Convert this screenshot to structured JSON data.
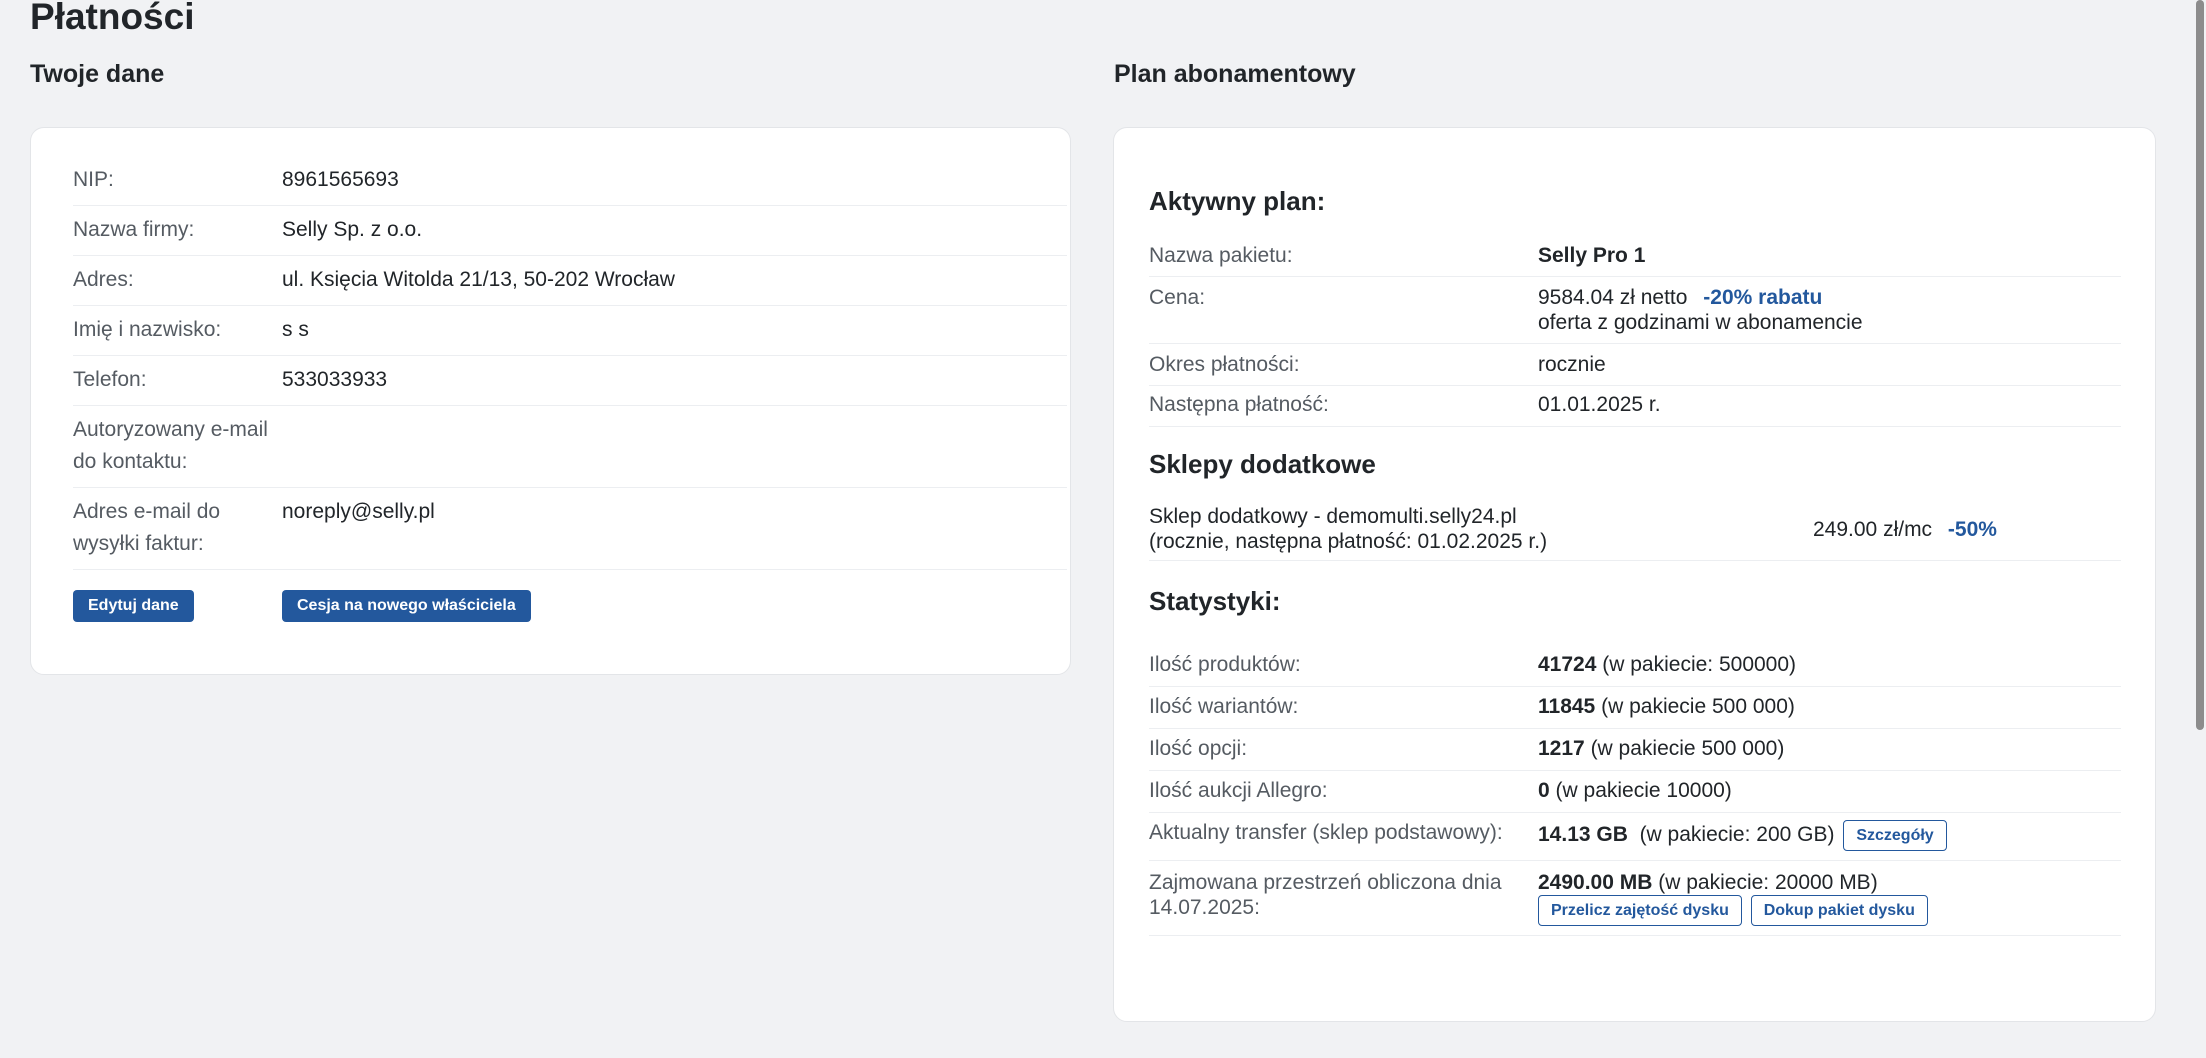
{
  "page": {
    "title": "Płatności"
  },
  "left": {
    "heading": "Twoje dane",
    "rows": [
      {
        "label": "NIP:",
        "value": "8961565693"
      },
      {
        "label": "Nazwa firmy:",
        "value": "Selly Sp. z o.o."
      },
      {
        "label": "Adres:",
        "value": "ul. Księcia Witolda 21/13, 50-202 Wrocław"
      },
      {
        "label": "Imię i nazwisko:",
        "value": "s s"
      },
      {
        "label": "Telefon:",
        "value": "533033933"
      },
      {
        "label": "Autoryzowany e-mail do kontaktu:",
        "value": ""
      },
      {
        "label": "Adres e-mail do wysyłki faktur:",
        "value": "noreply@selly.pl"
      }
    ],
    "edit_button": "Edytuj dane",
    "transfer_button": "Cesja na nowego właściciela"
  },
  "right": {
    "heading": "Plan abonamentowy",
    "active": {
      "title": "Aktywny plan:",
      "package_label": "Nazwa pakietu:",
      "package_value": "Selly Pro 1",
      "price_label": "Cena:",
      "price_value": "9584.04 zł netto",
      "price_discount": "-20% rabatu",
      "price_note": "oferta z godzinami w abonamencie",
      "period_label": "Okres płatności:",
      "period_value": "rocznie",
      "next_label": "Następna płatność:",
      "next_value": "01.01.2025 r."
    },
    "extra_shops": {
      "title": "Sklepy dodatkowe",
      "line1": "Sklep dodatkowy - demomulti.selly24.pl",
      "line2": "(rocznie, następna płatność: 01.02.2025 r.)",
      "price": "249.00 zł/mc",
      "discount": "-50%"
    },
    "stats": {
      "title": "Statystyki:",
      "products_label": "Ilość produktów:",
      "products_value": "41724",
      "products_note": "(w pakiecie: 500000)",
      "variants_label": "Ilość wariantów:",
      "variants_value": "11845",
      "variants_note": "(w pakiecie 500 000)",
      "options_label": "Ilość opcji:",
      "options_value": "1217",
      "options_note": "(w pakiecie 500 000)",
      "auctions_label": "Ilość aukcji Allegro:",
      "auctions_value": "0",
      "auctions_note": "(w pakiecie 10000)",
      "transfer_label": "Aktualny transfer (sklep podstawowy):",
      "transfer_value": "14.13 GB",
      "transfer_note": "(w pakiecie: 200 GB)",
      "details_button": "Szczegóły",
      "disk_label": "Zajmowana przestrzeń obliczona dnia 14.07.2025:",
      "disk_value": "2490.00 MB",
      "disk_note": "(w pakiecie: 20000 MB)",
      "recalc_button": "Przelicz zajętość dysku",
      "buy_button": "Dokup pakiet dysku"
    }
  }
}
